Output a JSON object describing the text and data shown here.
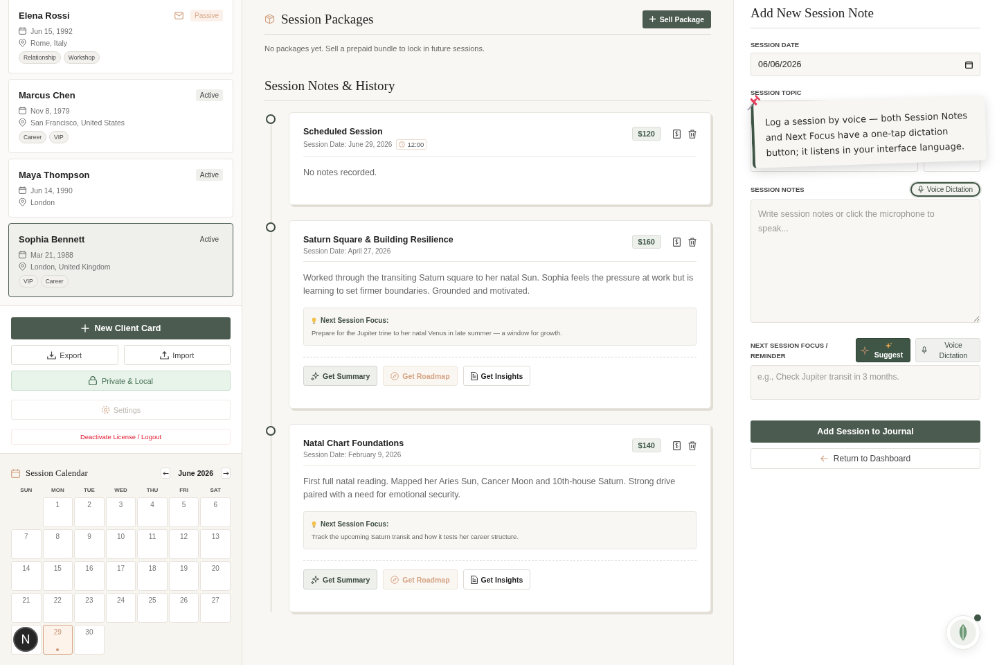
{
  "clients": [
    {
      "name": "Elena Rossi",
      "status": "Passive",
      "color": "#d8a98a",
      "has_email": true,
      "birth_date": "Jun 15, 1992",
      "location": "Rome, Italy",
      "tags": [
        "Relationship",
        "Workshop"
      ],
      "selected": false
    },
    {
      "name": "Marcus Chen",
      "status": "Active",
      "color": "#444444",
      "birth_date": "Nov 8, 1979",
      "location": "San Francisco, United States",
      "tags": [
        "Career",
        "VIP"
      ],
      "selected": false
    },
    {
      "name": "Maya Thompson",
      "status": "Active",
      "color": "#444444",
      "birth_date": "Jun 14, 1990",
      "location": "London",
      "selected": false
    },
    {
      "name": "Sophia Bennett",
      "status": "Active",
      "color": "#444444",
      "birth_date": "Mar 21, 1988",
      "location": "London, United Kingdom",
      "tags": [
        "VIP",
        "Career"
      ],
      "selected": true
    }
  ],
  "sidebar_actions": {
    "new_client": "New Client Card",
    "export": "Export",
    "import": "Import",
    "privacy": "Private & Local",
    "settings": "Settings",
    "logout": "Deactivate License / Logout"
  },
  "calendar": {
    "title": "Session Calendar",
    "month": "June 2026",
    "weekdays": [
      "SUN",
      "MON",
      "TUE",
      "WED",
      "THU",
      "FRI",
      "SAT"
    ],
    "days": [
      {
        "day": "1",
        "selected": false,
        "has_session": false
      },
      {
        "day": "2",
        "selected": false,
        "has_session": false
      },
      {
        "day": "3",
        "selected": false,
        "has_session": false
      },
      {
        "day": "4",
        "selected": false,
        "has_session": false
      },
      {
        "day": "5",
        "selected": false,
        "has_session": false
      },
      {
        "day": "6",
        "selected": false,
        "has_session": false
      },
      {
        "day": "7",
        "selected": false,
        "has_session": false
      },
      {
        "day": "8",
        "selected": false,
        "has_session": false
      },
      {
        "day": "9",
        "selected": false,
        "has_session": false
      },
      {
        "day": "10",
        "selected": false,
        "has_session": false
      },
      {
        "day": "11",
        "selected": false,
        "has_session": false
      },
      {
        "day": "12",
        "selected": false,
        "has_session": false
      },
      {
        "day": "13",
        "selected": false,
        "has_session": false
      },
      {
        "day": "14",
        "selected": false,
        "has_session": false
      },
      {
        "day": "15",
        "selected": false,
        "has_session": false
      },
      {
        "day": "16",
        "selected": false,
        "has_session": false
      },
      {
        "day": "17",
        "selected": false,
        "has_session": false
      },
      {
        "day": "18",
        "selected": false,
        "has_session": false
      },
      {
        "day": "19",
        "selected": false,
        "has_session": false
      },
      {
        "day": "20",
        "selected": false,
        "has_session": false
      },
      {
        "day": "21",
        "selected": false,
        "has_session": false
      },
      {
        "day": "22",
        "selected": false,
        "has_session": false
      },
      {
        "day": "23",
        "selected": false,
        "has_session": false
      },
      {
        "day": "24",
        "selected": false,
        "has_session": false
      },
      {
        "day": "25",
        "selected": false,
        "has_session": false
      },
      {
        "day": "26",
        "selected": false,
        "has_session": false
      },
      {
        "day": "27",
        "selected": false,
        "has_session": false
      },
      {
        "kind": "covered"
      },
      {
        "day": "29",
        "selected": true,
        "has_session": true
      },
      {
        "day": "30",
        "selected": false,
        "has_session": false
      }
    ]
  },
  "avatar": {
    "initial": "N"
  },
  "packages": {
    "title": "Session Packages",
    "button": "Sell Package",
    "empty_text": "No packages yet. Sell a prepaid bundle to lock in future sessions."
  },
  "history": {
    "title": "Session Notes & History",
    "sessions": [
      {
        "title": "Scheduled Session",
        "date": "Session Date: June 29, 2026",
        "time": "12:00",
        "price": "$120",
        "notes": "No notes recorded."
      },
      {
        "title": "Saturn Square & Building Resilience",
        "date": "Session Date: April 27, 2026",
        "price": "$160",
        "notes": "Worked through the transiting Saturn square to her natal Sun. Sophia feels the pressure at work but is learning to set firmer boundaries. Grounded and motivated.",
        "focus_label": "Next Session Focus:",
        "focus": "Prepare for the Jupiter trine to her natal Venus in late summer — a window for growth.",
        "actions": [
          "Get Summary",
          "Get Roadmap",
          "Get Insights"
        ]
      },
      {
        "title": "Natal Chart Foundations",
        "date": "Session Date: February 9, 2026",
        "price": "$140",
        "notes": "First full natal reading. Mapped her Aries Sun, Cancer Moon and 10th-house Saturn. Strong drive paired with a need for emotional security.",
        "focus_label": "Next Session Focus:",
        "focus": "Track the upcoming Saturn transit and how it tests her career structure.",
        "actions": [
          "Get Summary",
          "Get Roadmap",
          "Get Insights"
        ]
      }
    ]
  },
  "form": {
    "title": "Add New Session Note",
    "date_label": "SESSION DATE",
    "date_value": "06/06/2026",
    "topic_label": "SESSION TOPIC",
    "tooltip": "Log a session by voice — both Session Notes and Next Focus have a one-tap dictation button; it listens in your interface language.",
    "notes_label": "SESSION NOTES",
    "notes_dictation": "Voice Dictation",
    "notes_placeholder": "Write session notes or click the microphone to speak...",
    "focus_label": "NEXT SESSION FOCUS / REMINDER",
    "suggest": "Suggest",
    "focus_dictation": "Voice Dictation",
    "focus_placeholder": "e.g., Check Jupiter transit in 3 months.",
    "submit": "Add Session to Journal",
    "back": "Return to Dashboard"
  }
}
